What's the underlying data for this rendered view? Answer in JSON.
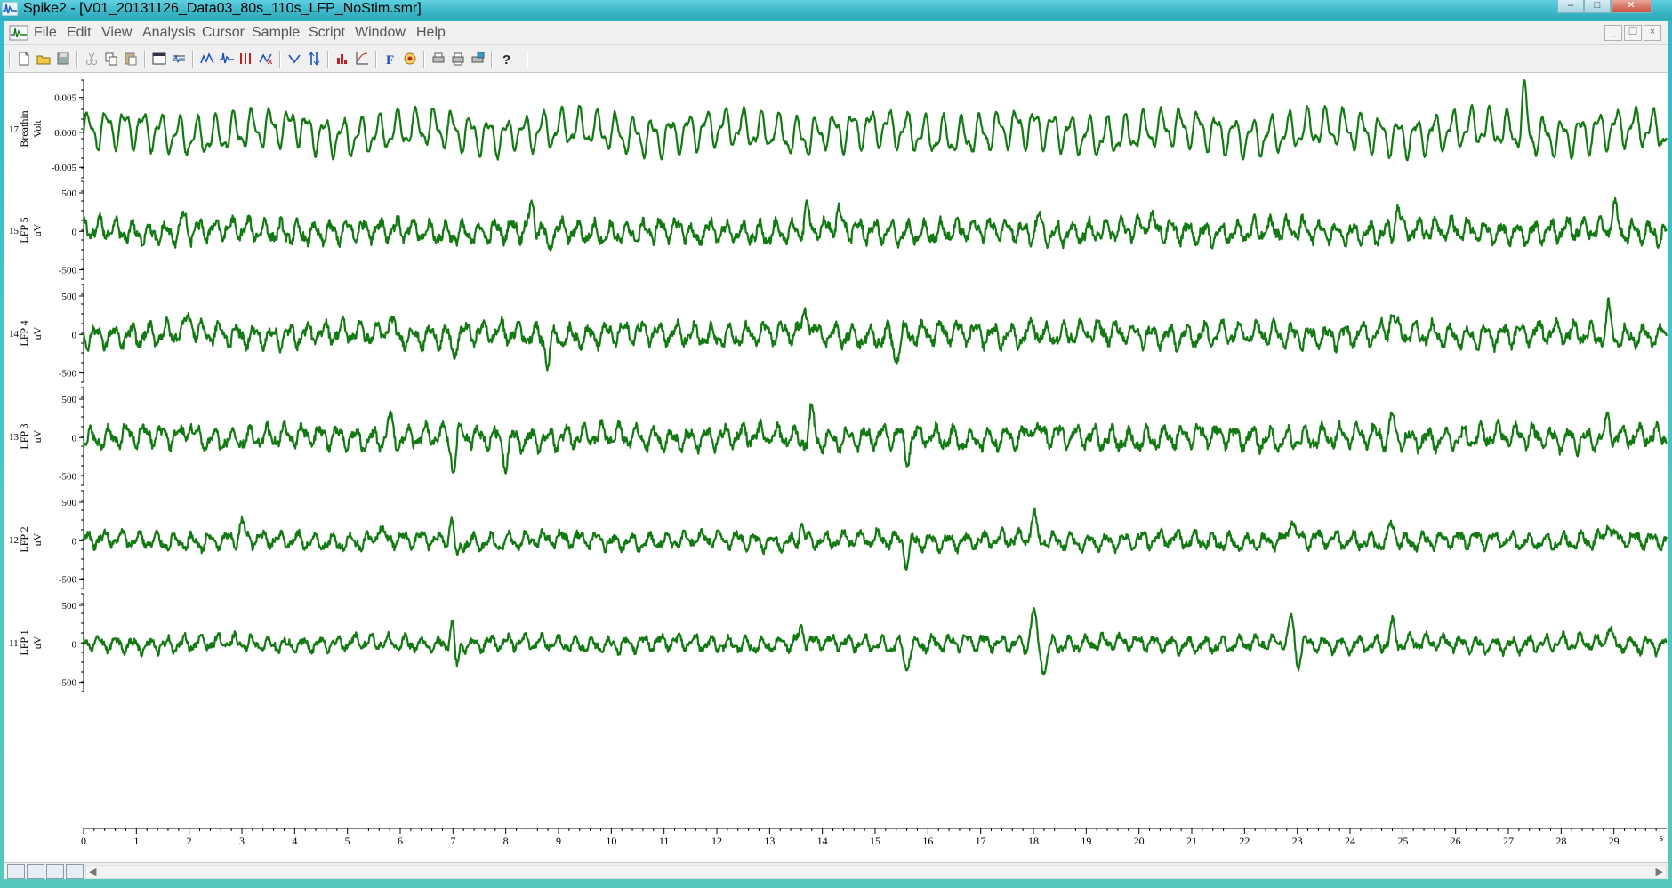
{
  "window": {
    "title": "Spike2 - [V01_20131126_Data03_80s_110s_LFP_NoStim.smr]"
  },
  "menu": {
    "items": [
      "File",
      "Edit",
      "View",
      "Analysis",
      "Cursor",
      "Sample",
      "Script",
      "Window",
      "Help"
    ]
  },
  "toolbar": {
    "icons": [
      "new-file-icon",
      "open-file-icon",
      "save-icon",
      "cut-icon",
      "copy-icon",
      "paste-icon",
      "new-view-icon",
      "channel-info-icon",
      "new-result-icon",
      "waveform-icon",
      "markers-icon",
      "xy-view-icon",
      "cursor-down-icon",
      "cursor-updown-icon",
      "histogram-icon",
      "log-icon",
      "f-icon",
      "help-lens-icon",
      "print-icon",
      "print-visible-icon",
      "print-screen-icon",
      "help-icon"
    ]
  },
  "colors": {
    "trace": "#137a13",
    "titlebar": "#3cb7c8",
    "menubar": "#f0f0f0"
  },
  "chart_data": {
    "type": "line",
    "xlabel": "s",
    "xlim": [
      0,
      30
    ],
    "x_ticks": [
      "0",
      "1",
      "2",
      "3",
      "4",
      "5",
      "6",
      "7",
      "8",
      "9",
      "10",
      "11",
      "12",
      "13",
      "14",
      "15",
      "16",
      "17",
      "18",
      "19",
      "20",
      "21",
      "22",
      "23",
      "24",
      "25",
      "26",
      "27",
      "28",
      "29"
    ],
    "channels": [
      {
        "num": "17",
        "name": "Breathin",
        "unit": "Volt",
        "ticks": [
          "0.005",
          "0.000",
          "-0.005"
        ],
        "tick_values": [
          0.005,
          0.0,
          -0.005
        ],
        "ylim": [
          -0.0065,
          0.0075
        ],
        "osc_freq": 2.9,
        "amp_scale": 0.0022,
        "noise": 0.00025,
        "events": [
          [
            4.0,
            0.0015
          ],
          [
            8.2,
            0.0012
          ],
          [
            13.1,
            0.0014
          ],
          [
            14.1,
            0.001
          ],
          [
            27.3,
            0.0048
          ]
        ]
      },
      {
        "num": "15",
        "name": "LFP 5",
        "unit": "uV",
        "ticks": [
          "500",
          "0",
          "-500"
        ],
        "tick_values": [
          500,
          0,
          -500
        ],
        "ylim": [
          -620,
          650
        ],
        "osc_freq": 3.2,
        "amp_scale": 110,
        "noise": 55,
        "events": [
          [
            1.9,
            180
          ],
          [
            8.5,
            300
          ],
          [
            8.8,
            -260
          ],
          [
            11.6,
            -220
          ],
          [
            13.7,
            260
          ],
          [
            14.3,
            230
          ],
          [
            18.1,
            170
          ],
          [
            20.2,
            200
          ],
          [
            24.9,
            330
          ],
          [
            29.0,
            300
          ]
        ]
      },
      {
        "num": "14",
        "name": "LFP 4",
        "unit": "uV",
        "ticks": [
          "500",
          "0",
          "-500"
        ],
        "tick_values": [
          500,
          0,
          -500
        ],
        "ylim": [
          -620,
          650
        ],
        "osc_freq": 3.0,
        "amp_scale": 110,
        "noise": 55,
        "events": [
          [
            2.0,
            260
          ],
          [
            5.8,
            250
          ],
          [
            7.0,
            -260
          ],
          [
            8.8,
            -320
          ],
          [
            13.7,
            330
          ],
          [
            15.4,
            -280
          ],
          [
            18.0,
            200
          ],
          [
            24.8,
            280
          ],
          [
            28.9,
            300
          ]
        ]
      },
      {
        "num": "13",
        "name": "LFP 3",
        "unit": "uV",
        "ticks": [
          "500",
          "0",
          "-500"
        ],
        "tick_values": [
          500,
          0,
          -500
        ],
        "ylim": [
          -620,
          650
        ],
        "osc_freq": 3.0,
        "amp_scale": 110,
        "noise": 55,
        "events": [
          [
            2.0,
            200
          ],
          [
            5.8,
            250
          ],
          [
            7.0,
            -380
          ],
          [
            8.0,
            -260
          ],
          [
            13.8,
            330
          ],
          [
            15.6,
            -310
          ],
          [
            18.0,
            200
          ],
          [
            24.8,
            230
          ],
          [
            28.9,
            250
          ]
        ]
      },
      {
        "num": "12",
        "name": "LFP 2",
        "unit": "uV",
        "ticks": [
          "500",
          "0",
          "-500"
        ],
        "tick_values": [
          500,
          0,
          -500
        ],
        "ylim": [
          -620,
          650
        ],
        "osc_freq": 3.0,
        "amp_scale": 80,
        "noise": 45,
        "events": [
          [
            3.0,
            200
          ],
          [
            5.6,
            200
          ],
          [
            7.0,
            450
          ],
          [
            7.05,
            -420
          ],
          [
            13.6,
            240
          ],
          [
            15.6,
            -250
          ],
          [
            18.0,
            330
          ],
          [
            22.9,
            320
          ],
          [
            24.8,
            260
          ],
          [
            28.9,
            230
          ]
        ]
      },
      {
        "num": "11",
        "name": "LFP 1",
        "unit": "uV",
        "ticks": [
          "500",
          "0",
          "-500"
        ],
        "tick_values": [
          500,
          0,
          -500
        ],
        "ylim": [
          -620,
          650
        ],
        "osc_freq": 3.1,
        "amp_scale": 75,
        "noise": 40,
        "events": [
          [
            7.0,
            500
          ],
          [
            7.05,
            -470
          ],
          [
            13.6,
            180
          ],
          [
            15.6,
            -260
          ],
          [
            18.0,
            450
          ],
          [
            18.2,
            -320
          ],
          [
            22.9,
            330
          ],
          [
            23.0,
            -280
          ],
          [
            24.8,
            220
          ],
          [
            28.9,
            230
          ]
        ]
      }
    ]
  },
  "bottombar": {
    "view_buttons": [
      "time-view-icon",
      "channel-view-icon",
      "mark-view-icon",
      "close-view-icon"
    ]
  }
}
